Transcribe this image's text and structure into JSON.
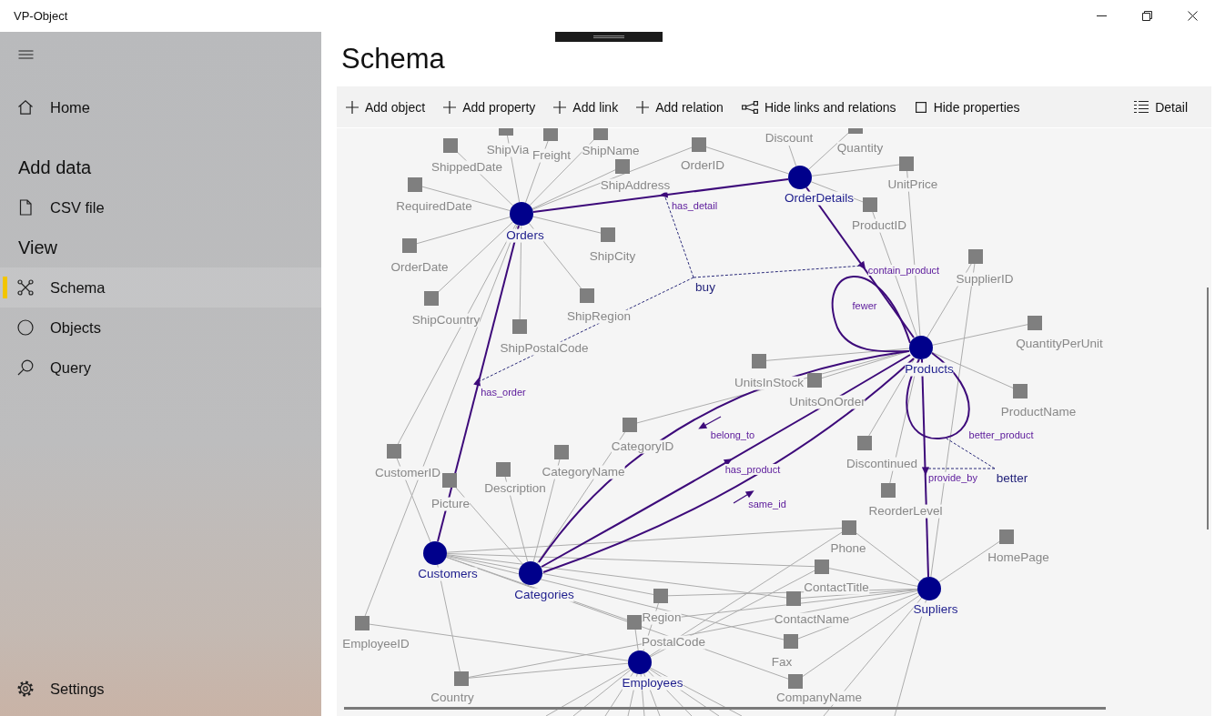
{
  "window": {
    "title": "VP-Object"
  },
  "sidebar": {
    "items": [
      {
        "label": "Home",
        "selected": false
      }
    ],
    "sections": [
      {
        "heading": "Add data",
        "items": [
          {
            "label": "CSV file",
            "selected": false
          }
        ]
      },
      {
        "heading": "View",
        "items": [
          {
            "label": "Schema",
            "selected": true
          },
          {
            "label": "Objects",
            "selected": false
          },
          {
            "label": "Query",
            "selected": false
          }
        ]
      }
    ],
    "footer_items": [
      {
        "label": "Settings",
        "selected": false
      }
    ]
  },
  "page": {
    "title": "Schema"
  },
  "toolbar": {
    "items": [
      {
        "kind": "add",
        "label": "Add object"
      },
      {
        "kind": "add",
        "label": "Add property"
      },
      {
        "kind": "add",
        "label": "Add link"
      },
      {
        "kind": "add",
        "label": "Add relation"
      },
      {
        "kind": "button",
        "label": "Hide links and relations"
      },
      {
        "kind": "checkbox",
        "label": "Hide properties",
        "checked": false
      }
    ],
    "detail_button": {
      "label": "Detail"
    }
  },
  "schema": {
    "objects": [
      {
        "label": "OrderDetails"
      },
      {
        "label": "Orders"
      },
      {
        "label": "Products"
      },
      {
        "label": "Customers"
      },
      {
        "label": "Categories"
      },
      {
        "label": "Supliers"
      },
      {
        "label": "Employees"
      }
    ],
    "properties": [
      {
        "label": "ShipVia"
      },
      {
        "label": "Freight"
      },
      {
        "label": "ShipName"
      },
      {
        "label": "Discount"
      },
      {
        "label": "Quantity"
      },
      {
        "label": "ShippedDate"
      },
      {
        "label": "OrderID"
      },
      {
        "label": "ShipAddress"
      },
      {
        "label": "UnitPrice"
      },
      {
        "label": "RequiredDate"
      },
      {
        "label": "ProductID"
      },
      {
        "label": "OrderDate"
      },
      {
        "label": "ShipCity"
      },
      {
        "label": "SupplierID"
      },
      {
        "label": "ShipCountry"
      },
      {
        "label": "ShipRegion"
      },
      {
        "label": "ShipPostalCode"
      },
      {
        "label": "QuantityPerUnit"
      },
      {
        "label": "UnitsInStock"
      },
      {
        "label": "UnitsOnOrder"
      },
      {
        "label": "ProductName"
      },
      {
        "label": "CategoryID"
      },
      {
        "label": "CustomerID"
      },
      {
        "label": "CategoryName"
      },
      {
        "label": "Discontinued"
      },
      {
        "label": "Description"
      },
      {
        "label": "Picture"
      },
      {
        "label": "ReorderLevel"
      },
      {
        "label": "Phone"
      },
      {
        "label": "HomePage"
      },
      {
        "label": "ContactTitle"
      },
      {
        "label": "Region"
      },
      {
        "label": "ContactName"
      },
      {
        "label": "EmployeeID"
      },
      {
        "label": "PostalCode"
      },
      {
        "label": "Fax"
      },
      {
        "label": "Country"
      },
      {
        "label": "CompanyName"
      }
    ],
    "links": [
      {
        "kind": "arrow",
        "label": "has_detail"
      },
      {
        "kind": "arrow",
        "label": "contain_product"
      },
      {
        "kind": "loop",
        "label": "fewer"
      },
      {
        "kind": "arrow",
        "label": "has_order"
      },
      {
        "kind": "arrow",
        "label": "belong_to"
      },
      {
        "kind": "loop",
        "label": "better_product"
      },
      {
        "kind": "arrow",
        "label": "has_product"
      },
      {
        "kind": "arrow",
        "label": "provide_by"
      },
      {
        "kind": "arrow",
        "label": "same_id"
      }
    ],
    "relations": [
      {
        "label": "buy"
      },
      {
        "label": "better"
      }
    ]
  }
}
